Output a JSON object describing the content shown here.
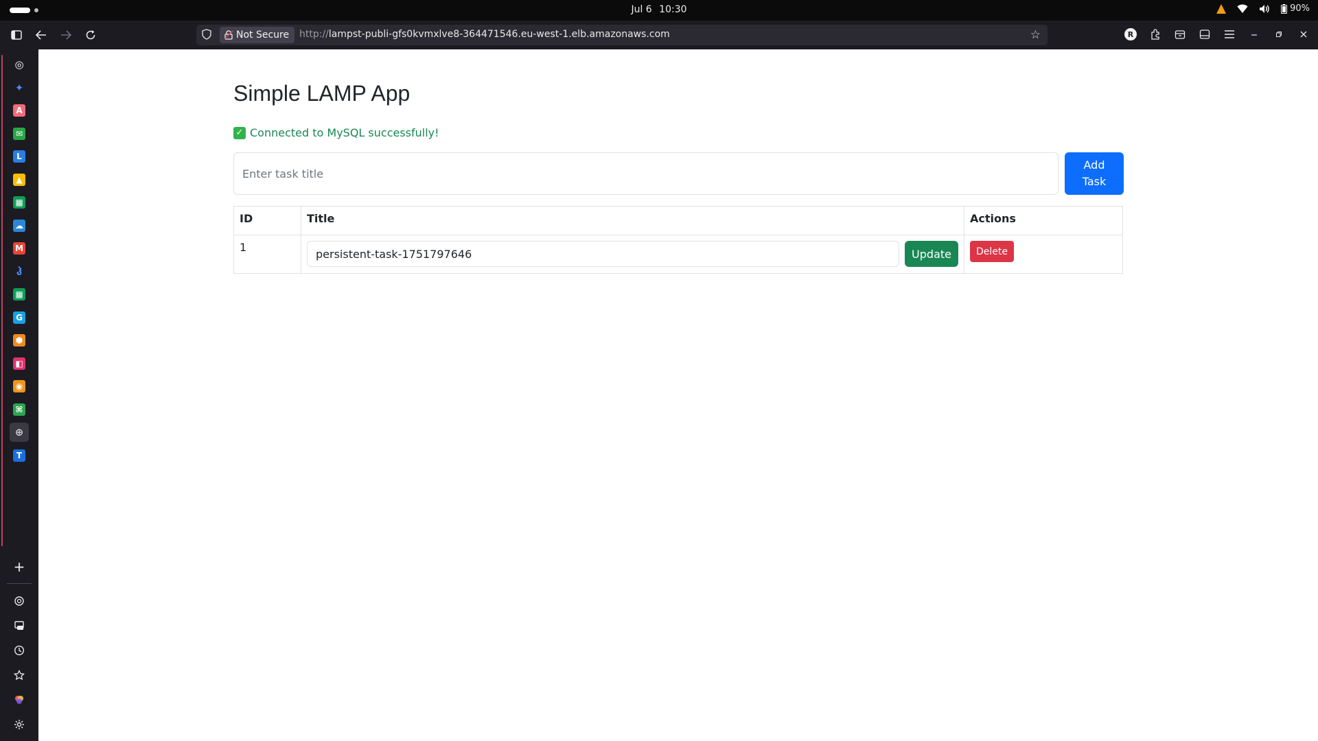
{
  "os": {
    "date": "Jul 6",
    "time": "10:30",
    "battery": "90%"
  },
  "browser": {
    "security_label": "Not Secure",
    "url_protocol": "http://",
    "url_host": "lampst-publi-gfs0kvmxlve8-364471546.eu-west-1.elb.amazonaws.com",
    "profile_initial": "R"
  },
  "sidebar": {
    "items": [
      {
        "name": "chatgpt",
        "color": "#ffffff",
        "glyph": "◎"
      },
      {
        "name": "gemini",
        "color": "#4a8cff",
        "glyph": "✦"
      },
      {
        "name": "anthropic",
        "color": "#f36b7a",
        "glyph": "A"
      },
      {
        "name": "mail",
        "color": "#28a745",
        "glyph": "✉"
      },
      {
        "name": "linear",
        "color": "#2a7de1",
        "glyph": "L"
      },
      {
        "name": "drive",
        "color": "#fbbc05",
        "glyph": "▲"
      },
      {
        "name": "sheets",
        "color": "#0f9d58",
        "glyph": "▦"
      },
      {
        "name": "onedrive",
        "color": "#2b88d8",
        "glyph": "☁"
      },
      {
        "name": "gmail",
        "color": "#ea4335",
        "glyph": "M"
      },
      {
        "name": "tool",
        "color": "#4a8cff",
        "glyph": "ჰ"
      },
      {
        "name": "sheets-2",
        "color": "#0f9d58",
        "glyph": "▦"
      },
      {
        "name": "app-blue",
        "color": "#18a0e4",
        "glyph": "G"
      },
      {
        "name": "app-orange",
        "color": "#f08a1c",
        "glyph": "⬢"
      },
      {
        "name": "app-pink",
        "color": "#e0346e",
        "glyph": "◧"
      },
      {
        "name": "app-amber",
        "color": "#f0951c",
        "glyph": "◉"
      },
      {
        "name": "app-green",
        "color": "#2da44e",
        "glyph": "⌘"
      },
      {
        "name": "browser",
        "color": "#cccccc",
        "glyph": "⊕"
      },
      {
        "name": "teams",
        "color": "#1a6fe0",
        "glyph": "T"
      }
    ]
  },
  "page": {
    "title": "Simple LAMP App",
    "status": "Connected to MySQL successfully!",
    "input_placeholder": "Enter task title",
    "add_button": "Add\nTask",
    "table": {
      "headers": [
        "ID",
        "Title",
        "Actions"
      ],
      "rows": [
        {
          "id": "1",
          "title": "persistent-task-1751797646",
          "update_label": "Update",
          "delete_label": "Delete"
        }
      ]
    }
  }
}
